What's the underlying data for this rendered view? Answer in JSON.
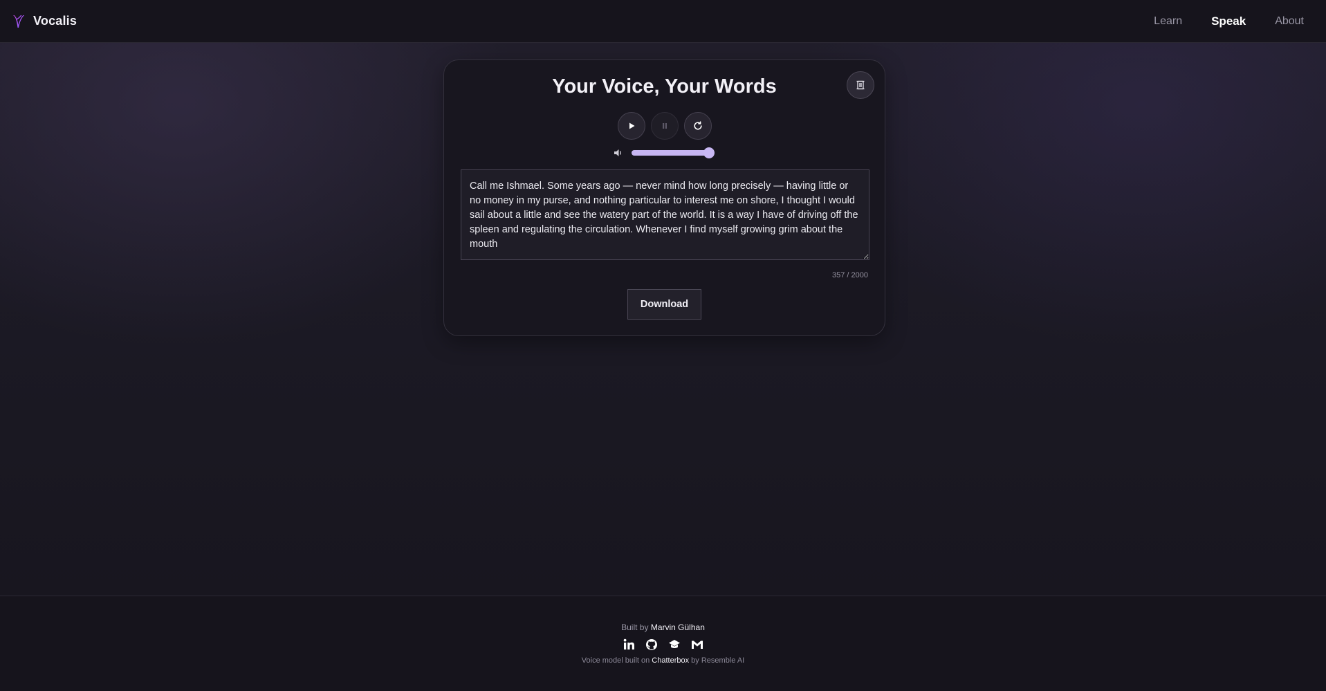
{
  "header": {
    "brand": "Vocalis",
    "nav": [
      {
        "label": "Learn",
        "active": false
      },
      {
        "label": "Speak",
        "active": true
      },
      {
        "label": "About",
        "active": false
      }
    ]
  },
  "card": {
    "title": "Your Voice, Your Words",
    "corner_icon": "scroll-icon",
    "controls": {
      "play_icon": "play-icon",
      "pause_icon": "pause-icon",
      "reset_icon": "refresh-icon",
      "pause_enabled": false
    },
    "volume": {
      "icon": "volume-icon",
      "level": 1.0
    },
    "text": "Call me Ishmael. Some years ago — never mind how long precisely — having little or no money in my purse, and nothing particular to interest me on shore, I thought I would sail about a little and see the watery part of the world. It is a way I have of driving off the spleen and regulating the circulation. Whenever I find myself growing grim about the mouth",
    "char_count": "357 / 2000",
    "download_label": "Download"
  },
  "footer": {
    "built_by_prefix": "Built by",
    "author": "Marvin Gülhan",
    "socials": [
      "linkedin-icon",
      "github-icon",
      "scholar-icon",
      "gmail-icon"
    ],
    "credit_prefix": "Voice model built on",
    "credit_model": "Chatterbox",
    "credit_suffix": "by Resemble AI"
  },
  "colors": {
    "accent": "#c7b6f2",
    "logo_gradient": [
      "#c13cf0",
      "#7a5cf5"
    ],
    "background": "#1c1a25"
  }
}
